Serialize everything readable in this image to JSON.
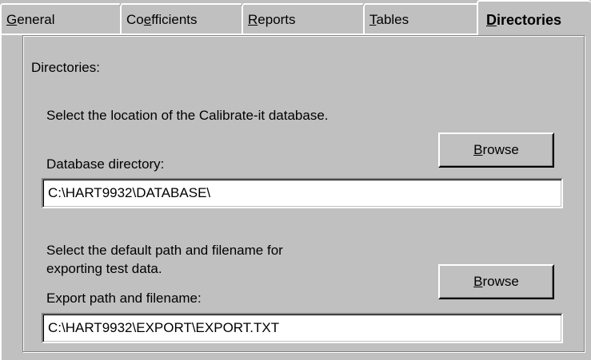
{
  "tabs": {
    "general": {
      "mnemonic": "G",
      "rest": "eneral"
    },
    "coefficients": {
      "before": "Co",
      "mnemonic": "e",
      "after": "fficients"
    },
    "reports": {
      "mnemonic": "R",
      "rest": "eports"
    },
    "tables": {
      "mnemonic": "T",
      "rest": "ables"
    },
    "directories": {
      "mnemonic": "D",
      "rest": "irectories"
    }
  },
  "active_tab": "Directories",
  "group": {
    "title": "Directories:"
  },
  "database": {
    "instruction": "Select the location of the Calibrate-it database.",
    "field_label": "Database directory:",
    "value": "C:\\HART9932\\DATABASE\\",
    "browse": {
      "mnemonic": "B",
      "rest": "rowse"
    }
  },
  "export": {
    "instruction_line1": "Select the default path and filename for",
    "instruction_line2": "exporting test data.",
    "field_label": "Export path and filename:",
    "value": "C:\\HART9932\\EXPORT\\EXPORT.TXT",
    "browse": {
      "mnemonic": "B",
      "rest": "rowse"
    }
  },
  "colors": {
    "face": "#c0c0c0",
    "highlight": "#ffffff",
    "shadow": "#808080",
    "dark_shadow": "#000000",
    "field_background": "#ffffff"
  }
}
